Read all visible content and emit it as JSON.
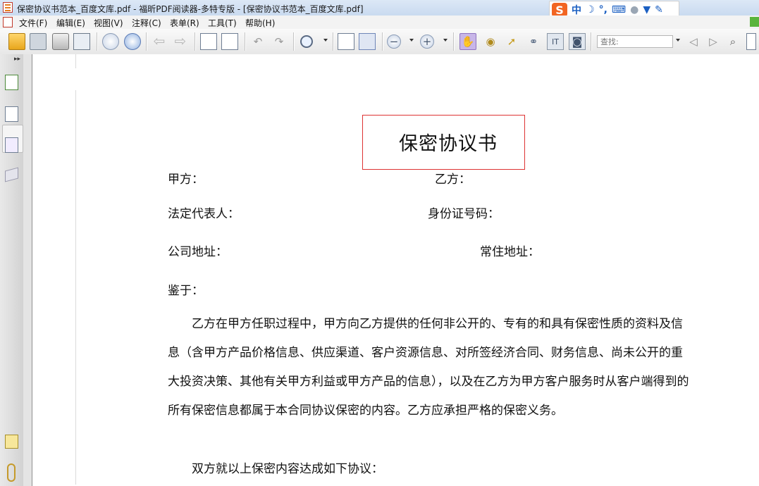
{
  "window": {
    "title": "保密协议书范本_百度文库.pdf - 福昕PDF阅读器-多特专版 - [保密协议书范本_百度文库.pdf]"
  },
  "ime": {
    "logo": "S",
    "mode": "中",
    "moon": "☽",
    "punct": "°,",
    "keyboard": "⌨",
    "user": "👤",
    "skin": "👕",
    "tool": "🔧"
  },
  "menu": {
    "items": [
      "文件(F)",
      "编辑(E)",
      "视图(V)",
      "注释(C)",
      "表单(R)",
      "工具(T)",
      "帮助(H)"
    ]
  },
  "toolbar": {
    "find_placeholder": "查找:"
  },
  "document": {
    "title": "保密协议书",
    "party_a": "甲方：",
    "party_b": "乙方：",
    "legal_rep": "法定代表人：",
    "id_number": "身份证号码：",
    "company_address": "公司地址：",
    "residence_address": "常住地址：",
    "whereas": "鉴于：",
    "paragraph_lines": [
      "　　乙方在甲方任职过程中，甲方向乙方提供的任何非公开的、专有的和具有保密性质的资料及信",
      "息（含甲方产品价格信息、供应渠道、客户资源信息、对所签经济合同、财务信息、尚未公开的重",
      "大投资决策、其他有关甲方利益或甲方产品的信息），以及在乙方为甲方客户服务时从客户端得到的",
      "所有保密信息都属于本合同协议保密的内容。乙方应承担严格的保密义务。"
    ],
    "agreement": "　　双方就以上保密内容达成如下协议："
  },
  "colors": {
    "title_border": "#dd3333",
    "titlebar": "#c9daf0",
    "accent_green": "#5ab43c"
  }
}
